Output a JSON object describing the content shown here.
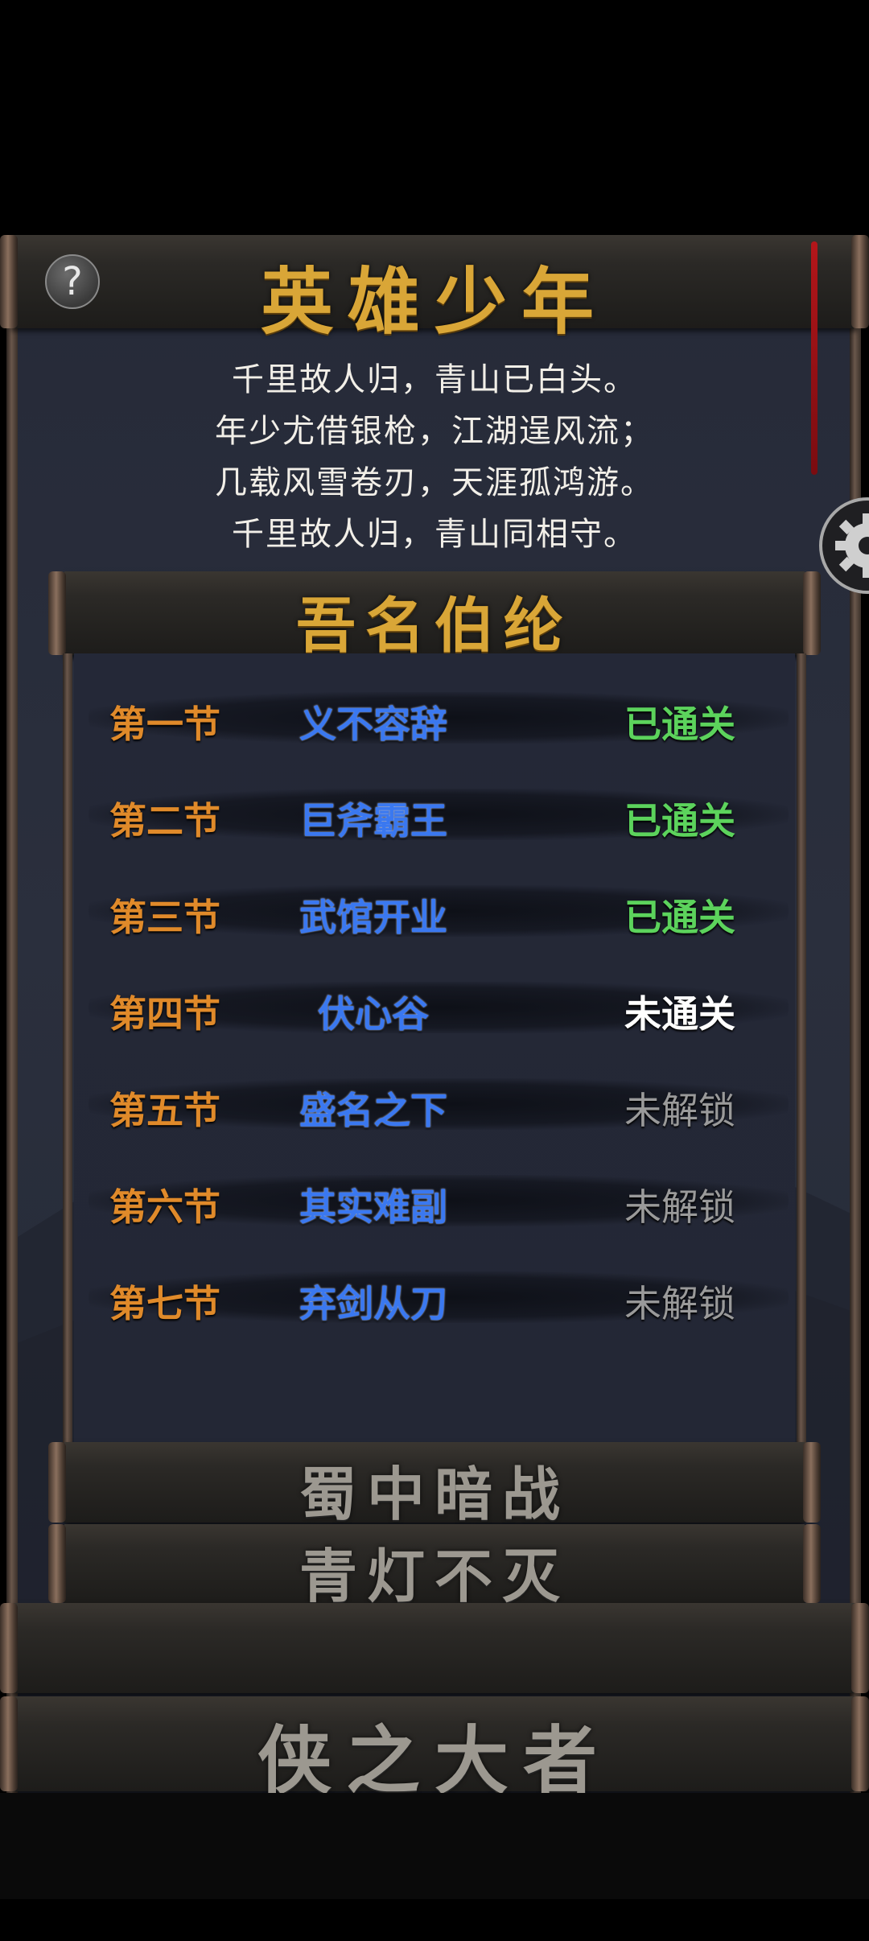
{
  "header": {
    "title": "英雄少年"
  },
  "poem": {
    "lines": [
      "千里故人归，青山已白头。",
      "年少尤借银枪，江湖逞风流；",
      "几载风雪卷刃，天涯孤鸿游。",
      "千里故人归，青山同相守。"
    ]
  },
  "chapter_open": {
    "title": "吾名伯纶"
  },
  "sections": [
    {
      "section": "第一节",
      "name": "义不容辞",
      "status": "已通关"
    },
    {
      "section": "第二节",
      "name": "巨斧霸王",
      "status": "已通关"
    },
    {
      "section": "第三节",
      "name": "武馆开业",
      "status": "已通关"
    },
    {
      "section": "第四节",
      "name": "伏心谷",
      "status": "未通关"
    },
    {
      "section": "第五节",
      "name": "盛名之下",
      "status": "未解锁"
    },
    {
      "section": "第六节",
      "name": "其实难副",
      "status": "未解锁"
    },
    {
      "section": "第七节",
      "name": "弃剑从刀",
      "status": "未解锁"
    }
  ],
  "chapters_locked": [
    {
      "title": "蜀中暗战"
    },
    {
      "title": "青灯不灭"
    }
  ],
  "footer": {
    "title": "侠之大者"
  },
  "icons": {
    "help": "help-icon",
    "settings": "gear-icon"
  },
  "colors": {
    "section": "#e08a2a",
    "name": "#3a78f0",
    "cleared": "#5cd35c",
    "current": "#ffffff",
    "locked": "#9a9a9a",
    "gold": "#d9a637"
  }
}
